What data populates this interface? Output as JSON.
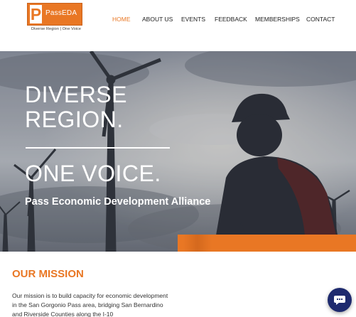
{
  "header": {
    "logo_letter": "P",
    "logo_name": "PassEDA",
    "logo_tagline": "Diverse Region  |  One Voice",
    "nav": [
      {
        "label": "HOME",
        "active": true
      },
      {
        "label": "ABOUT US",
        "active": false
      },
      {
        "label": "EVENTS",
        "active": false
      },
      {
        "label": "FEEDBACK",
        "active": false
      },
      {
        "label": "MEMBERSHIPS",
        "active": false
      },
      {
        "label": "CONTACT",
        "active": false
      }
    ]
  },
  "hero": {
    "heading_line1": "DIVERSE",
    "heading_line2": "REGION.",
    "subheading": "ONE VOICE.",
    "tagline": "Pass Economic Development Alliance"
  },
  "mission": {
    "title": "OUR MISSION",
    "text": "Our mission is to build capacity for economic development in the San Gorgonio Pass area, bridging San Bernardino and Riverside Counties along the I-10"
  },
  "chat": {
    "icon": "chat-bubble-icon"
  },
  "colors": {
    "accent": "#e97724",
    "chat": "#1e2a6e",
    "text": "#222222"
  }
}
